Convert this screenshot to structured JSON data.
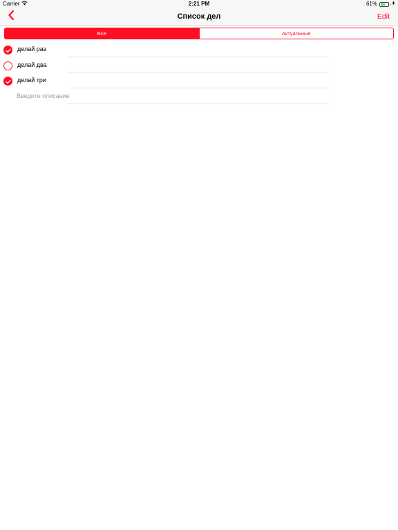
{
  "status_bar": {
    "carrier": "Carrier",
    "time": "2:21 PM",
    "battery": "61%",
    "battery_level": 0.61
  },
  "nav": {
    "back_icon": "chevron-left-icon",
    "title": "Список дел",
    "edit_label": "Edit"
  },
  "segments": [
    {
      "label": "Все",
      "selected": true
    },
    {
      "label": "Актуальные",
      "selected": false
    }
  ],
  "tasks": [
    {
      "title": "делай раз",
      "done": true
    },
    {
      "title": "делай два",
      "done": false
    },
    {
      "title": "делай три",
      "done": true
    }
  ],
  "new_task": {
    "placeholder": "Введите описание",
    "value": ""
  },
  "colors": {
    "accent": "#ff0f24",
    "separator": "#e2e2e2",
    "placeholder": "#a0a0a0"
  }
}
